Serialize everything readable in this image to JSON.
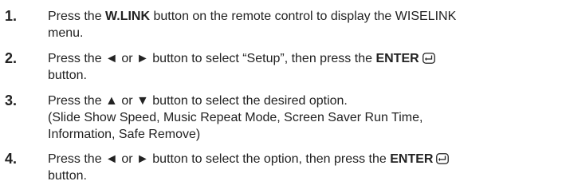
{
  "steps": [
    {
      "number": "1.",
      "l1_pre": "Press the ",
      "l1_bold": "W.LINK",
      "l1_post": " button on the remote control to display the WISELINK",
      "l2": "menu."
    },
    {
      "number": "2.",
      "l1_pre": "Press the ◄ or ► button to select “Setup”, then press the ",
      "l1_bold": "ENTER",
      "l2": "button."
    },
    {
      "number": "3.",
      "l1": "Press the ▲ or ▼ button to select the desired option.",
      "l2": "(Slide Show Speed, Music Repeat Mode, Screen Saver Run Time,",
      "l3": "Information, Safe Remove)"
    },
    {
      "number": "4.",
      "l1_pre": "Press the ◄ or ► button to select the option, then press the ",
      "l1_bold": "ENTER",
      "l2": "button."
    }
  ],
  "icons": {
    "enter": "enter-icon"
  }
}
